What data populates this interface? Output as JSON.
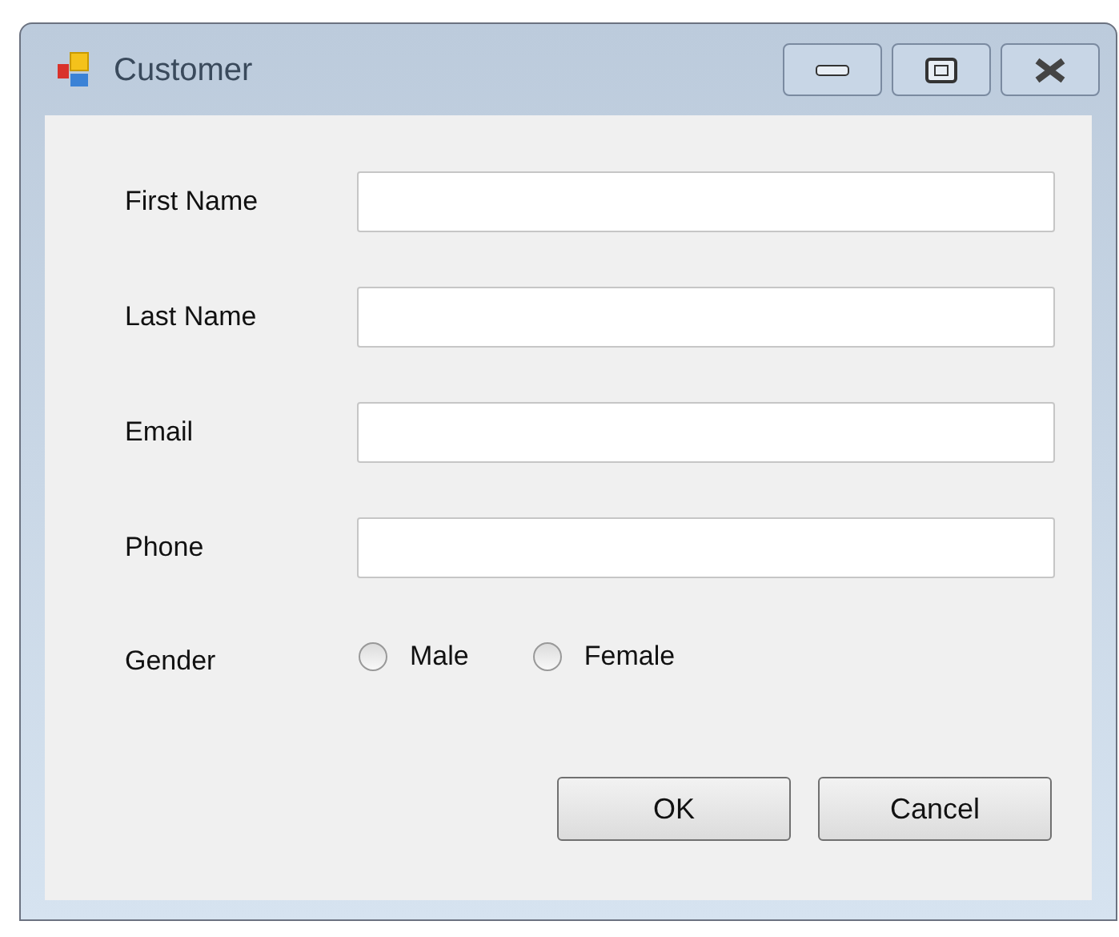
{
  "window": {
    "title": "Customer"
  },
  "fields": [
    {
      "label": "First Name"
    },
    {
      "label": "Last Name"
    },
    {
      "label": "Email"
    },
    {
      "label": "Phone"
    }
  ],
  "gender": {
    "label": "Gender",
    "options": [
      {
        "label": "Male",
        "selected": false
      },
      {
        "label": "Female",
        "selected": false
      }
    ]
  },
  "buttons": [
    "OK",
    "Cancel"
  ]
}
